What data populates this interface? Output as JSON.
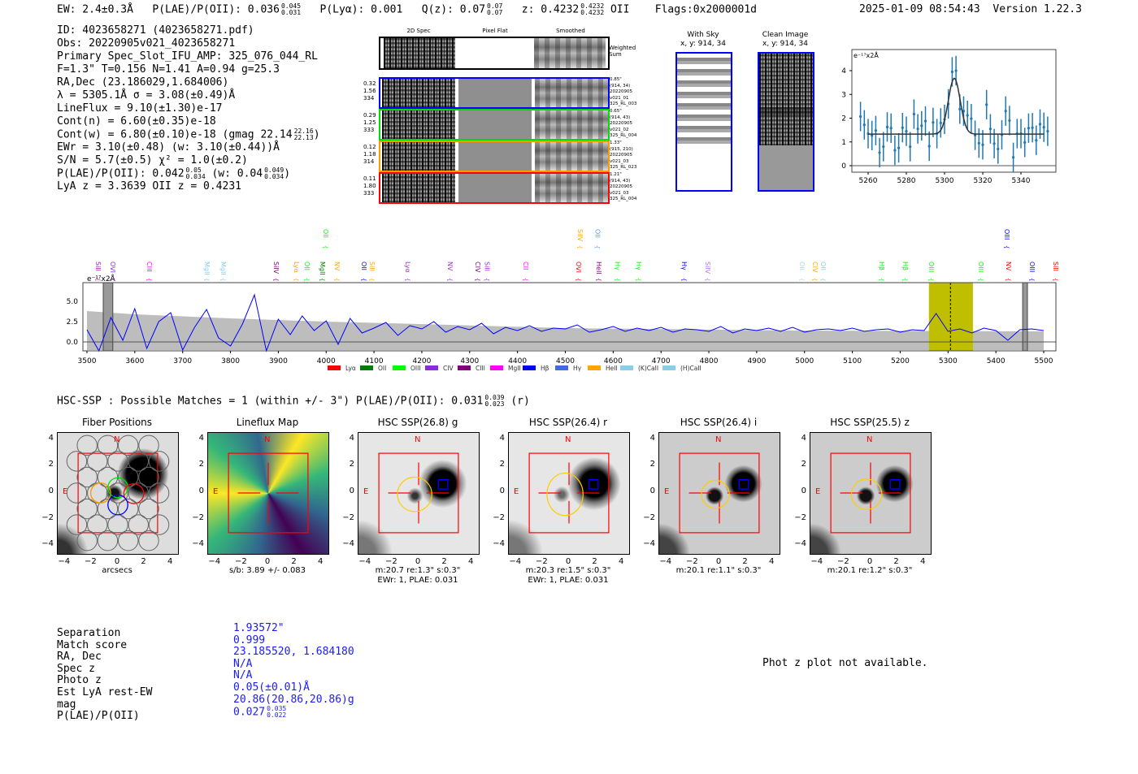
{
  "header": {
    "ew": "EW: 2.4±0.3Å",
    "plae_label": "P(LAE)/P(OII): 0.036",
    "plae_hi": "0.045",
    "plae_lo": "0.031",
    "plya": "P(Lyα): 0.001",
    "qz_label": "Q(z): 0.07",
    "qz_hi": "0.07",
    "qz_lo": "0.07",
    "z_label": "z: 0.4232",
    "z_hi": "0.4232",
    "z_lo": "0.4232",
    "z_line": "OII",
    "flags": "Flags:0x2000001d",
    "datetime": "2025-01-09 08:54:43",
    "version": "Version 1.22.3"
  },
  "info": {
    "id": "ID: 4023658271 (4023658271.pdf)",
    "obs": "Obs: 20220905v021_4023658271",
    "primary": "Primary Spec_Slot_IFU_AMP: 325_076_044_RL",
    "params": "F=1.3\"  T=0.156  N=1.41  A=0.94  g=25.3",
    "radec": "RA,Dec (23.186029,1.684006)",
    "lambda": "λ = 5305.1Å  σ = 3.08(±0.49)Å",
    "lineflux": "LineFlux = 9.10(±1.30)e-17",
    "contn": "Cont(n) = 6.60(±0.35)e-18",
    "contw": "Cont(w) = 6.80(±0.10)e-18 (gmag 22.14",
    "contw_hi": "22.16",
    "contw_lo": "22.13",
    "contw_end": ")",
    "ewr": "EWr = 3.10(±0.48) (w: 3.10(±0.44))Å",
    "sn": "S/N = 5.7(±0.5)  χ² = 1.0(±0.2)",
    "plae": "P(LAE)/P(OII): 0.042",
    "plae_hi": "0.05",
    "plae_lo": "0.034",
    "plae_w": "(w: 0.04",
    "plae_w_hi": "0.049",
    "plae_w_lo": "0.034",
    "plae_w_end": ")",
    "z": "LyA z = 3.3639   OII z = 0.4231"
  },
  "spec2d": {
    "columns": [
      "2D Spec",
      "Pixel Flat",
      "Smoothed"
    ],
    "weighted_label": "Weighted Sum",
    "rows": [
      {
        "color": "#0000ff",
        "left": [
          "0.32",
          "1.56",
          "334"
        ],
        "right": [
          "0.85\"",
          "(914, 34)",
          "20220905",
          "v021_01",
          "325_RL_003"
        ]
      },
      {
        "color": "#00dd00",
        "left": [
          "0.29",
          "1.25",
          "333"
        ],
        "right": [
          "0.65\"",
          "(914, 43)",
          "20220905",
          "v021_02",
          "325_RL_004"
        ]
      },
      {
        "color": "#ff9900",
        "left": [
          "0.12",
          "1.18",
          "314"
        ],
        "right": [
          "1.33\"",
          "(915, 210)",
          "20220905",
          "v021_03",
          "325_RL_023"
        ]
      },
      {
        "color": "#ff0000",
        "left": [
          "0.11",
          "1.80",
          "333"
        ],
        "right": [
          "1.21\"",
          "(914, 43)",
          "20220905",
          "v021_03",
          "325_RL_004"
        ]
      }
    ]
  },
  "ccd": {
    "with_sky": "With Sky",
    "with_sky_xy": "x, y: 914, 34",
    "clean": "Clean Image",
    "clean_xy": "x, y: 914, 34"
  },
  "hsc": {
    "summary": "HSC-SSP : Possible Matches = 1 (within +/- 3\")  P(LAE)/P(OII): 0.031",
    "summary_hi": "0.039",
    "summary_lo": "0.023",
    "summary_end": "(r)",
    "panels": [
      {
        "title": "Fiber Positions",
        "caption1": "arcsecs",
        "caption2": ""
      },
      {
        "title": "Lineflux Map",
        "caption1": "s/b: 3.89 +/- 0.083",
        "caption2": ""
      },
      {
        "title": "HSC SSP(26.8) g",
        "caption1": "m:20.7  re:1.3\"  s:0.3\"",
        "caption2": "EWr: 1, PLAE: 0.031"
      },
      {
        "title": "HSC SSP(26.4) r",
        "caption1": "m:20.3  re:1.5\"  s:0.3\"",
        "caption2": "EWr: 1, PLAE: 0.031"
      },
      {
        "title": "HSC SSP(26.4) i",
        "caption1": "m:20.1  re:1.1\"  s:0.3\"",
        "caption2": ""
      },
      {
        "title": "HSC SSP(25.5) z",
        "caption1": "m:20.1  re:1.2\"  s:0.3\"",
        "caption2": ""
      }
    ],
    "ticks": [
      "−4",
      "−2",
      "0",
      "2",
      "4"
    ],
    "north": "N",
    "east": "E"
  },
  "match": {
    "labels": [
      "Separation",
      "Match score",
      "RA, Dec",
      "Spec z",
      "Photo z",
      "Est LyA rest-EW",
      "mag",
      "P(LAE)/P(OII)"
    ],
    "values": [
      "1.93572\"",
      "0.999",
      "23.185520, 1.684180",
      "N/A",
      "N/A",
      "0.05(±0.01)Å",
      "20.86(20.86,20.86)g",
      "0.027"
    ],
    "plae_hi": "0.035",
    "plae_lo": "0.022"
  },
  "photz_note": "Phot z plot not available.",
  "chart_data": [
    {
      "type": "line",
      "name_hint": "full spectrum",
      "ylabel": "e⁻¹⁷x2Å",
      "xlim": [
        3470,
        5530
      ],
      "ylim": [
        -1.1,
        7.3
      ],
      "xticks": [
        3500,
        3600,
        3700,
        3800,
        3900,
        4000,
        4100,
        4200,
        4300,
        4400,
        4500,
        4600,
        4700,
        4800,
        4900,
        5000,
        5100,
        5200,
        5300,
        5400,
        5500
      ],
      "yticks": [
        "0.0",
        "2.5",
        "5.0"
      ],
      "ytick_values": [
        0,
        2.5,
        5
      ],
      "x_start": 3500,
      "x_step": 25,
      "flux": [
        1.5,
        -1.2,
        3.0,
        0.2,
        4.1,
        -0.8,
        2.5,
        3.6,
        -1.0,
        1.8,
        4.0,
        0.5,
        -0.5,
        2.2,
        5.8,
        -1.1,
        2.8,
        0.9,
        3.2,
        1.4,
        2.6,
        -0.3,
        2.9,
        1.1,
        1.7,
        2.4,
        0.8,
        2.0,
        1.6,
        2.5,
        1.2,
        1.9,
        1.5,
        2.3,
        1.0,
        1.8,
        1.4,
        2.0,
        1.3,
        1.7,
        1.6,
        2.1,
        1.2,
        1.5,
        1.9,
        1.3,
        1.7,
        1.4,
        1.8,
        1.2,
        1.6,
        1.5,
        1.3,
        1.9,
        1.1,
        1.6,
        1.4,
        1.7,
        1.3,
        1.8,
        1.2,
        1.5,
        1.6,
        1.4,
        1.7,
        1.3,
        1.5,
        1.6,
        1.2,
        1.5,
        1.4,
        3.5,
        1.3,
        1.6,
        1.1,
        1.7,
        1.4,
        0.2,
        1.5,
        1.6,
        1.4
      ],
      "noise_x": [
        3500,
        3600,
        3800,
        4000,
        4200,
        4500,
        5000,
        5500
      ],
      "noise_hi": [
        3.8,
        3.4,
        2.9,
        2.5,
        2.2,
        1.7,
        1.4,
        1.3
      ],
      "noise_lo": [
        -1.0,
        -1.0,
        -1.0,
        -1.0,
        -1.0,
        -1.0,
        -1.0,
        -1.0
      ],
      "highlight_range": [
        5260,
        5352
      ],
      "line_center": 5305.1,
      "masked": [
        [
          3534,
          3554
        ],
        [
          5456,
          5466
        ]
      ],
      "line_labels": [
        {
          "label": "SiII",
          "x": 3514,
          "color": "#a020a0",
          "row": 1
        },
        {
          "label": "OVI",
          "x": 3544,
          "color": "#8a2be2",
          "row": 1
        },
        {
          "label": "CIII",
          "x": 3621,
          "color": "#ff00ff",
          "row": 1
        },
        {
          "label": "MgII",
          "x": 3741,
          "color": "#87ceeb",
          "row": 1
        },
        {
          "label": "MgII",
          "x": 3775,
          "color": "#87ceeb",
          "row": 1
        },
        {
          "label": "SiIV",
          "x": 3886,
          "color": "#800080",
          "row": 1
        },
        {
          "label": "Lyα",
          "x": 3928,
          "color": "#ffa500",
          "row": 1
        },
        {
          "label": "OII",
          "x": 3950,
          "color": "#00ff00",
          "row": 1
        },
        {
          "label": "MgII",
          "x": 3983,
          "color": "#008000",
          "row": 1
        },
        {
          "label": "NV",
          "x": 4013,
          "color": "#ffa500",
          "row": 1
        },
        {
          "label": "OII",
          "x": 4069,
          "color": "#0000ff",
          "row": 1
        },
        {
          "label": "SiII",
          "x": 4086,
          "color": "#ffa500",
          "row": 1
        },
        {
          "label": "Lyα",
          "x": 4161,
          "color": "#9932cc",
          "row": 1
        },
        {
          "label": "NV",
          "x": 4249,
          "color": "#9932cc",
          "row": 1
        },
        {
          "label": "CIV",
          "x": 4307,
          "color": "#800080",
          "row": 1
        },
        {
          "label": "SiII",
          "x": 4327,
          "color": "#9932cc",
          "row": 1
        },
        {
          "label": "CII",
          "x": 4407,
          "color": "#ff00ff",
          "row": 1
        },
        {
          "label": "OVI",
          "x": 4518,
          "color": "#ff0000",
          "row": 1
        },
        {
          "label": "HeII",
          "x": 4560,
          "color": "#800080",
          "row": 1
        },
        {
          "label": "Hγ",
          "x": 4599,
          "color": "#00ff00",
          "row": 1
        },
        {
          "label": "Hγ",
          "x": 4644,
          "color": "#00ff00",
          "row": 1
        },
        {
          "label": "Hγ",
          "x": 4739,
          "color": "#0000ff",
          "row": 1
        },
        {
          "label": "SiIV",
          "x": 4788,
          "color": "#b070ff",
          "row": 1
        },
        {
          "label": "OII",
          "x": 4985,
          "color": "#add8e6",
          "row": 1
        },
        {
          "label": "CIV",
          "x": 5012,
          "color": "#ffa500",
          "row": 1
        },
        {
          "label": "OII",
          "x": 5029,
          "color": "#87ceeb",
          "row": 1
        },
        {
          "label": "Hβ",
          "x": 5152,
          "color": "#00ff00",
          "row": 1
        },
        {
          "label": "Hβ",
          "x": 5201,
          "color": "#00ff00",
          "row": 1
        },
        {
          "label": "OIII",
          "x": 5255,
          "color": "#00ff00",
          "row": 1
        },
        {
          "label": "OIII",
          "x": 5359,
          "color": "#00ff00",
          "row": 1
        },
        {
          "label": "NV",
          "x": 5417,
          "color": "#ff0000",
          "row": 1
        },
        {
          "label": "OIII",
          "x": 5466,
          "color": "#0000ff",
          "row": 1
        },
        {
          "label": "SiII",
          "x": 5515,
          "color": "#ff0000",
          "row": 1
        },
        {
          "label": "OII",
          "x": 3989,
          "color": "#00ff00",
          "row": 2
        },
        {
          "label": "SiIV",
          "x": 4521,
          "color": "#ffa500",
          "row": 2
        },
        {
          "label": "OII",
          "x": 4558,
          "color": "#6495ed",
          "row": 2
        },
        {
          "label": "OIII",
          "x": 5413,
          "color": "#0000ff",
          "row": 2
        }
      ],
      "legend": [
        {
          "label": "Lyα",
          "color": "#ff0000"
        },
        {
          "label": "OII",
          "color": "#008000"
        },
        {
          "label": "OIII",
          "color": "#00ff00"
        },
        {
          "label": "CIV",
          "color": "#8a2be2"
        },
        {
          "label": "CIII",
          "color": "#800080"
        },
        {
          "label": "MgII",
          "color": "#ff00ff"
        },
        {
          "label": "Hβ",
          "color": "#0000ff"
        },
        {
          "label": "Hγ",
          "color": "#4169e1"
        },
        {
          "label": "HeII",
          "color": "#ffa500"
        },
        {
          "label": "(K)CaII",
          "color": "#87ceeb"
        },
        {
          "label": "(H)CaII",
          "color": "#87ceeb"
        }
      ],
      "colors": {
        "flux": "#0000ff",
        "noise": "#bdbdbd",
        "highlight": "#bfbf00"
      }
    },
    {
      "type": "scatter",
      "name_hint": "line fit",
      "ylabel": "e⁻¹⁷x2Å",
      "xlim": [
        5252,
        5358
      ],
      "ylim": [
        -0.25,
        4.75
      ],
      "xticks": [
        5260,
        5280,
        5300,
        5320,
        5340
      ],
      "yticks": [
        0,
        1,
        2,
        3,
        4
      ],
      "x": [
        5256,
        5258,
        5260,
        5262,
        5264,
        5266,
        5268,
        5270,
        5272,
        5274,
        5276,
        5278,
        5280,
        5282,
        5284,
        5286,
        5288,
        5290,
        5292,
        5294,
        5296,
        5298,
        5300,
        5302,
        5304,
        5306,
        5308,
        5310,
        5312,
        5314,
        5316,
        5318,
        5320,
        5322,
        5324,
        5326,
        5328,
        5330,
        5332,
        5334,
        5336,
        5338,
        5340,
        5342,
        5344,
        5346,
        5348,
        5350,
        5352,
        5354
      ],
      "y": [
        2.07,
        1.72,
        1.35,
        1.27,
        1.48,
        0.55,
        0.8,
        1.63,
        1.58,
        0.65,
        0.75,
        1.6,
        1.45,
        0.8,
        2.17,
        1.55,
        1.68,
        1.88,
        0.82,
        1.82,
        1.35,
        1.8,
        1.95,
        2.6,
        3.95,
        4.0,
        2.38,
        2.3,
        2.12,
        1.98,
        1.28,
        0.95,
        0.88,
        2.57,
        1.55,
        0.93,
        0.7,
        1.3,
        2.3,
        1.9,
        0.35,
        1.35,
        1.35,
        0.98,
        1.58,
        1.6,
        1.07,
        1.75,
        1.62,
        1.45
      ],
      "yerr": 0.62,
      "fit": {
        "continuum": 1.33,
        "amplitude": 2.35,
        "center": 5305.1,
        "sigma": 3.08,
        "range": [
          5260,
          5352
        ]
      },
      "colors": {
        "points": "#1f77b4",
        "fit": "#333333"
      }
    }
  ]
}
